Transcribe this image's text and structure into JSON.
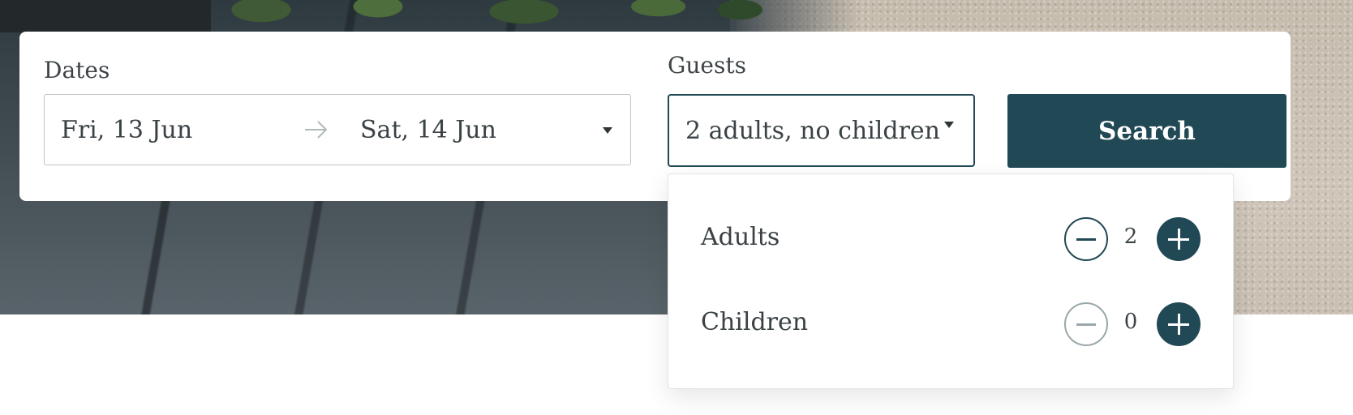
{
  "search": {
    "dates_label": "Dates",
    "check_in": "Fri, 13 Jun",
    "check_out": "Sat, 14 Jun",
    "guests_label": "Guests",
    "guests_summary": "2 adults, no children",
    "search_button": "Search"
  },
  "guests_dropdown": {
    "adults": {
      "label": "Adults",
      "value": "2",
      "minus_enabled": true
    },
    "children": {
      "label": "Children",
      "value": "0",
      "minus_enabled": false
    }
  },
  "colors": {
    "accent": "#214955",
    "text": "#3b4245",
    "disabled": "#9aa7ab"
  },
  "icons": [
    "arrow-right-icon",
    "caret-down-icon",
    "minus-icon",
    "plus-icon"
  ]
}
